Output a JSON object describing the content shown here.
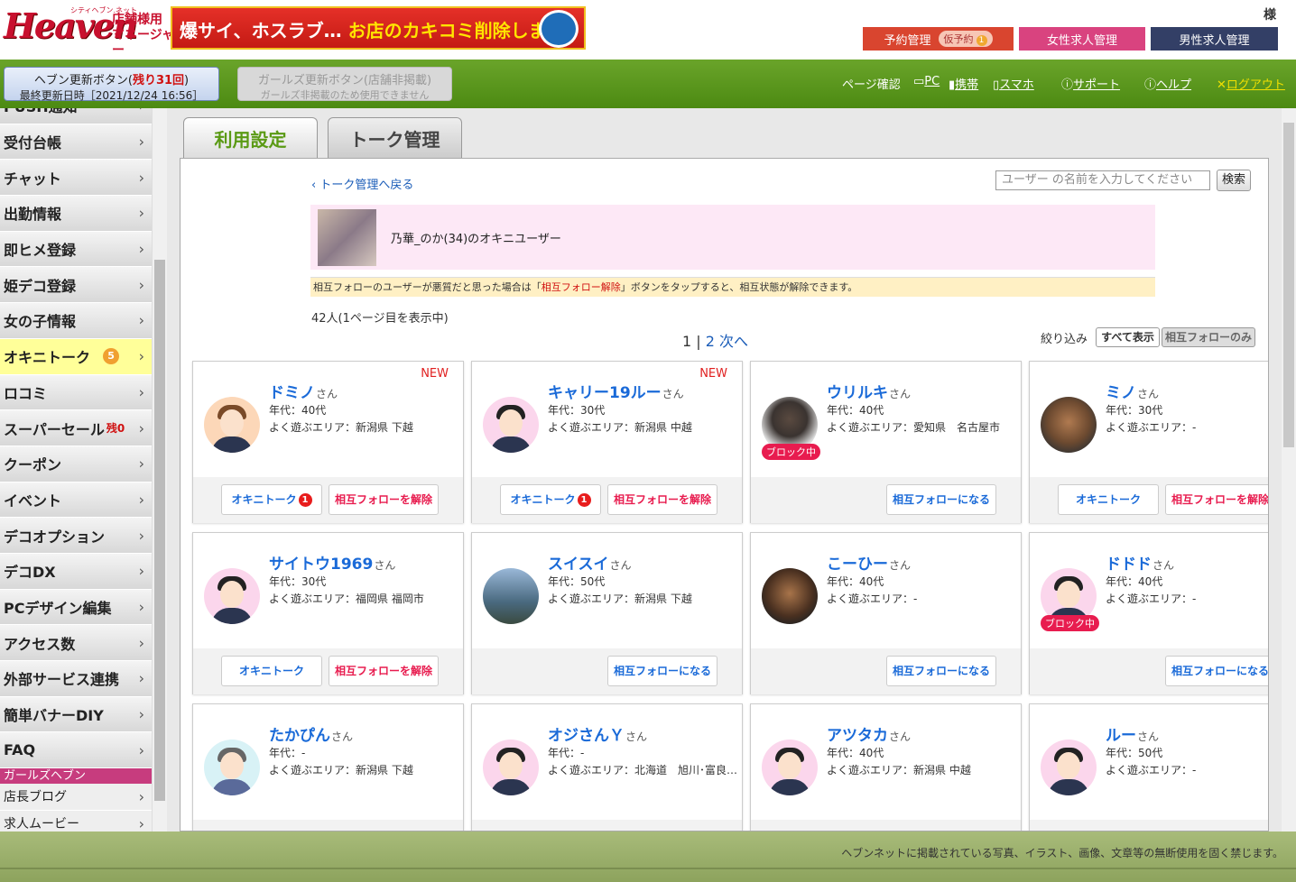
{
  "header": {
    "logo": {
      "main": "Heaven",
      "sub1": "店舗様用",
      "sub2": "マネージャー",
      "tiny": "シティヘブン.ネット"
    },
    "banner": {
      "text1": "爆サイ、ホスラブ…",
      "text2": "お店のカキコミ削除します!"
    },
    "user_suffix": "様",
    "buttons": {
      "reservation": "予約管理",
      "temp_reservation": "仮予約",
      "temp_count": "1",
      "female_recruit": "女性求人管理",
      "male_recruit": "男性求人管理"
    }
  },
  "updatebar": {
    "heaven_update": "ヘブン更新ボタン(",
    "remaining": "残り31回",
    "close": ")",
    "last_update": "最終更新日時［2021/12/24 16:56］",
    "girls_update": "ガールズ更新ボタン(店舗非掲載)",
    "girls_note": "ガールズ非掲載のため使用できません"
  },
  "nav": {
    "page_check": "ページ確認",
    "pc": "PC",
    "mobile": "携帯",
    "smartphone": "スマホ",
    "support": "サポート",
    "help": "ヘルプ",
    "logout": "ログアウト"
  },
  "sidebar": {
    "items": [
      {
        "label": "PUSH通知"
      },
      {
        "label": "受付台帳"
      },
      {
        "label": "チャット"
      },
      {
        "label": "出勤情報"
      },
      {
        "label": "即ヒメ登録"
      },
      {
        "label": "姫デコ登録"
      },
      {
        "label": "女の子情報"
      },
      {
        "label": "オキニトーク",
        "badge": "5"
      },
      {
        "label": "ロコミ"
      },
      {
        "label": "スーパーセール",
        "sale": "残0"
      },
      {
        "label": "クーポン"
      },
      {
        "label": "イベント"
      },
      {
        "label": "デコオプション"
      },
      {
        "label": "デコDX"
      },
      {
        "label": "PCデザイン編集"
      },
      {
        "label": "アクセス数"
      },
      {
        "label": "外部サービス連携"
      },
      {
        "label": "簡単バナーDIY"
      },
      {
        "label": "FAQ"
      }
    ],
    "group_title": "ガールズヘブン",
    "sub_items": [
      {
        "label": "店長ブログ"
      },
      {
        "label": "求人ムービー"
      }
    ]
  },
  "tabs": {
    "usage_settings": "利用設定",
    "talk_management": "トーク管理"
  },
  "main": {
    "back_link": "トーク管理へ戻る",
    "search_placeholder": "ユーザー の名前を入力してください",
    "search_button": "検索",
    "user_name": "乃華_のか(34)のオキニユーザー",
    "notice_pre": "相互フォローのユーザーが悪質だと思った場合は「",
    "notice_mid": "相互フォロー解除",
    "notice_post": "」ボタンをタップすると、相互状態が解除できます。",
    "count": "42人(1ページ目を表示中)",
    "pager": {
      "current": "1",
      "sep": "|",
      "page2": "2",
      "next": "次へ"
    },
    "filter_label": "絞り込み",
    "filter_all": "すべて表示",
    "filter_mutual": "相互フォローのみ"
  },
  "labels": {
    "san": "さん",
    "age_prefix": "年代：",
    "area_prefix": "よく遊ぶエリア：",
    "new": "NEW",
    "blocked": "ブロック中",
    "talk": "オキニトーク",
    "unfollow": "相互フォローを解除",
    "follow": "相互フォローになる"
  },
  "cards": [
    {
      "name": "ドミノ",
      "age": "40代",
      "area": "新潟県 下越",
      "new": true,
      "talk_badge": "1",
      "mutual": true
    },
    {
      "name": "キャリー19ルー",
      "age": "30代",
      "area": "新潟県 中越",
      "new": true,
      "talk_badge": "1",
      "mutual": true
    },
    {
      "name": "ウリルキ",
      "age": "40代",
      "area": "愛知県　名古屋市",
      "blocked": true,
      "mutual": false
    },
    {
      "name": "ミノ",
      "age": "30代",
      "area": "-",
      "mutual": true
    },
    {
      "name": "サイトウ1969",
      "age": "30代",
      "area": "福岡県 福岡市",
      "mutual": true
    },
    {
      "name": "スイスイ",
      "age": "50代",
      "area": "新潟県 下越",
      "mutual": false
    },
    {
      "name": "こーひー",
      "age": "40代",
      "area": "-",
      "mutual": false
    },
    {
      "name": "ドドド",
      "age": "40代",
      "area": "-",
      "blocked": true,
      "mutual": false
    },
    {
      "name": "たかぴん",
      "age": "-",
      "area": "新潟県 下越"
    },
    {
      "name": "オジさんＹ",
      "age": "-",
      "area": "北海道　旭川･富良…"
    },
    {
      "name": "アツタカ",
      "age": "40代",
      "area": "新潟県 中越"
    },
    {
      "name": "ルー",
      "age": "50代",
      "area": "-"
    }
  ],
  "footer": {
    "copyright": "ヘブンネットに掲載されている写真、イラスト、画像、文章等の無断使用を固く禁じます。"
  },
  "colors": {
    "green": "#4c8a12",
    "pink": "#fde8f6",
    "link": "#1a6ad8",
    "red": "#e81c4f"
  }
}
